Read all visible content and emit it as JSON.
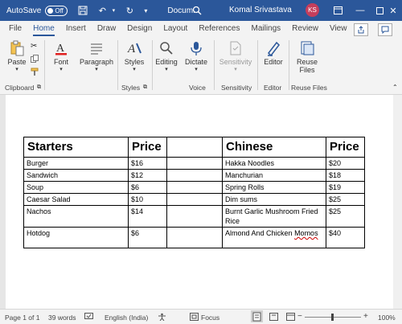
{
  "titlebar": {
    "autosave_label": "AutoSave",
    "autosave_state": "Off",
    "doc_name": "Docum...",
    "user_name": "Komal Srivastava",
    "user_initials": "KS"
  },
  "menu": {
    "items": [
      "File",
      "Home",
      "Insert",
      "Draw",
      "Design",
      "Layout",
      "References",
      "Mailings",
      "Review",
      "View"
    ],
    "active": "Home"
  },
  "ribbon": {
    "paste": "Paste",
    "font": "Font",
    "paragraph": "Paragraph",
    "styles": "Styles",
    "editing": "Editing",
    "dictate": "Dictate",
    "sensitivity": "Sensitivity",
    "editor": "Editor",
    "reuse_files_line1": "Reuse",
    "reuse_files_line2": "Files",
    "groups": {
      "clipboard": "Clipboard",
      "styles": "Styles",
      "voice": "Voice",
      "sensitivity": "Sensitivity",
      "editor": "Editor",
      "reuse_files": "Reuse Files"
    }
  },
  "table": {
    "headers": [
      "Starters",
      "Price",
      "",
      "Chinese",
      "Price"
    ],
    "rows": [
      [
        "Burger",
        "$16",
        "",
        "Hakka Noodles",
        "$20"
      ],
      [
        "Sandwich",
        "$12",
        "",
        "Manchurian",
        "$18"
      ],
      [
        "Soup",
        "$6",
        "",
        "Spring Rolls",
        "$19"
      ],
      [
        "Caesar Salad",
        "$10",
        "",
        "Dim sums",
        "$25"
      ],
      [
        "Nachos",
        "$14",
        "",
        "Burnt Garlic Mushroom Fried Rice",
        "$25"
      ],
      [
        "Hotdog",
        "$6",
        "",
        "Almond And Chicken Momos",
        "$40"
      ]
    ]
  },
  "status": {
    "page": "Page 1 of 1",
    "words": "39 words",
    "language": "English (India)",
    "focus": "Focus",
    "zoom": "100%"
  }
}
